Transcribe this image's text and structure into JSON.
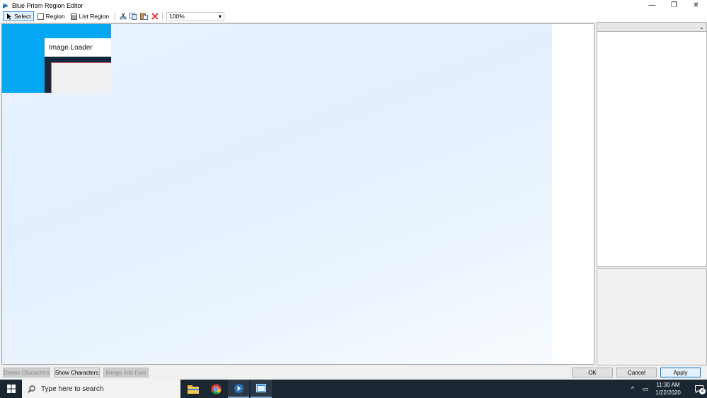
{
  "window": {
    "title": "Blue Prism Region Editor",
    "minimize": "—",
    "restore": "❐",
    "close": "✕"
  },
  "toolbar": {
    "select_label": "Select",
    "region_label": "Region",
    "list_region_label": "List Region",
    "zoom_value": "100%"
  },
  "canvas": {
    "captured_window_title": "Image Loader"
  },
  "buttons": {
    "delete_characters": "Delete Characters",
    "show_characters": "Show Characters",
    "merge_into_font": "Merge Into Font",
    "ok": "OK",
    "cancel": "Cancel",
    "apply": "Apply"
  },
  "taskbar": {
    "search_placeholder": "Type here to search",
    "time": "11:30 AM",
    "date": "1/22/2020",
    "notification_count": "4"
  },
  "colors": {
    "accent": "#0078d7",
    "captured_blue": "#06a7f2",
    "taskbar": "#1b2633"
  }
}
